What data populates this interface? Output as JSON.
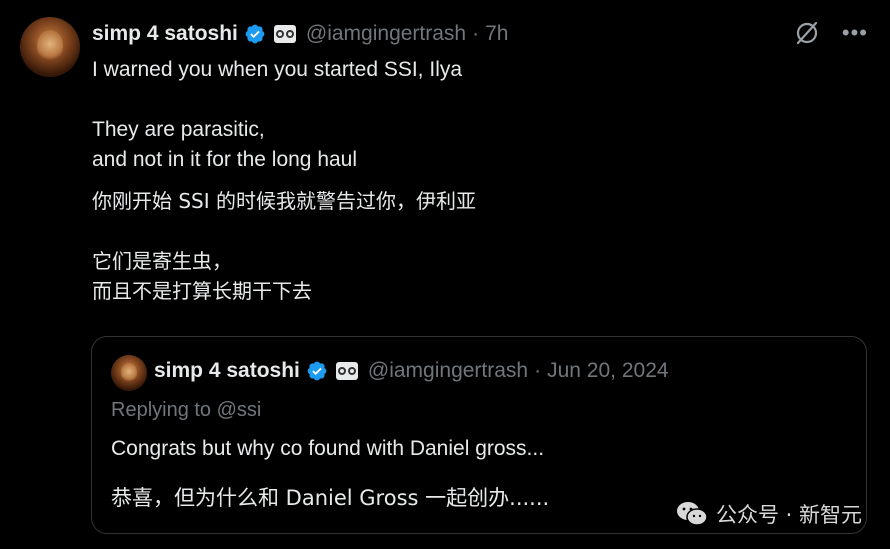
{
  "tweet": {
    "author_name": "simp 4 satoshi",
    "handle": "@iamgingertrash",
    "separator": "·",
    "time": "7h",
    "lines_en_1": "I warned you when you started SSI, Ilya",
    "lines_en_2a": "They are parasitic,",
    "lines_en_2b": "and not in it for the long haul",
    "lines_zh_1": "你刚开始 SSI 的时候我就警告过你，伊利亚",
    "lines_zh_2a": "它们是寄生虫，",
    "lines_zh_2b": "而且不是打算长期干下去"
  },
  "quoted": {
    "author_name": "simp 4 satoshi",
    "handle": "@iamgingertrash",
    "separator": "·",
    "date": "Jun 20, 2024",
    "replying_to": "Replying to @ssi",
    "text_en": "Congrats but why co found with Daniel gross...",
    "text_zh": "恭喜，但为什么和 Daniel Gross 一起创办......"
  },
  "watermark": {
    "text": "公众号 · 新智元"
  },
  "icons": {
    "verified": "verified-badge-icon",
    "affiliation": "affiliation-badge-icon",
    "grok": "grok-icon",
    "more": "more-icon",
    "wechat": "wechat-icon"
  },
  "colors": {
    "background": "#000000",
    "text": "#e7e9ea",
    "secondary": "#71767b",
    "verified_blue": "#1d9bf0",
    "border": "#2f3336"
  }
}
